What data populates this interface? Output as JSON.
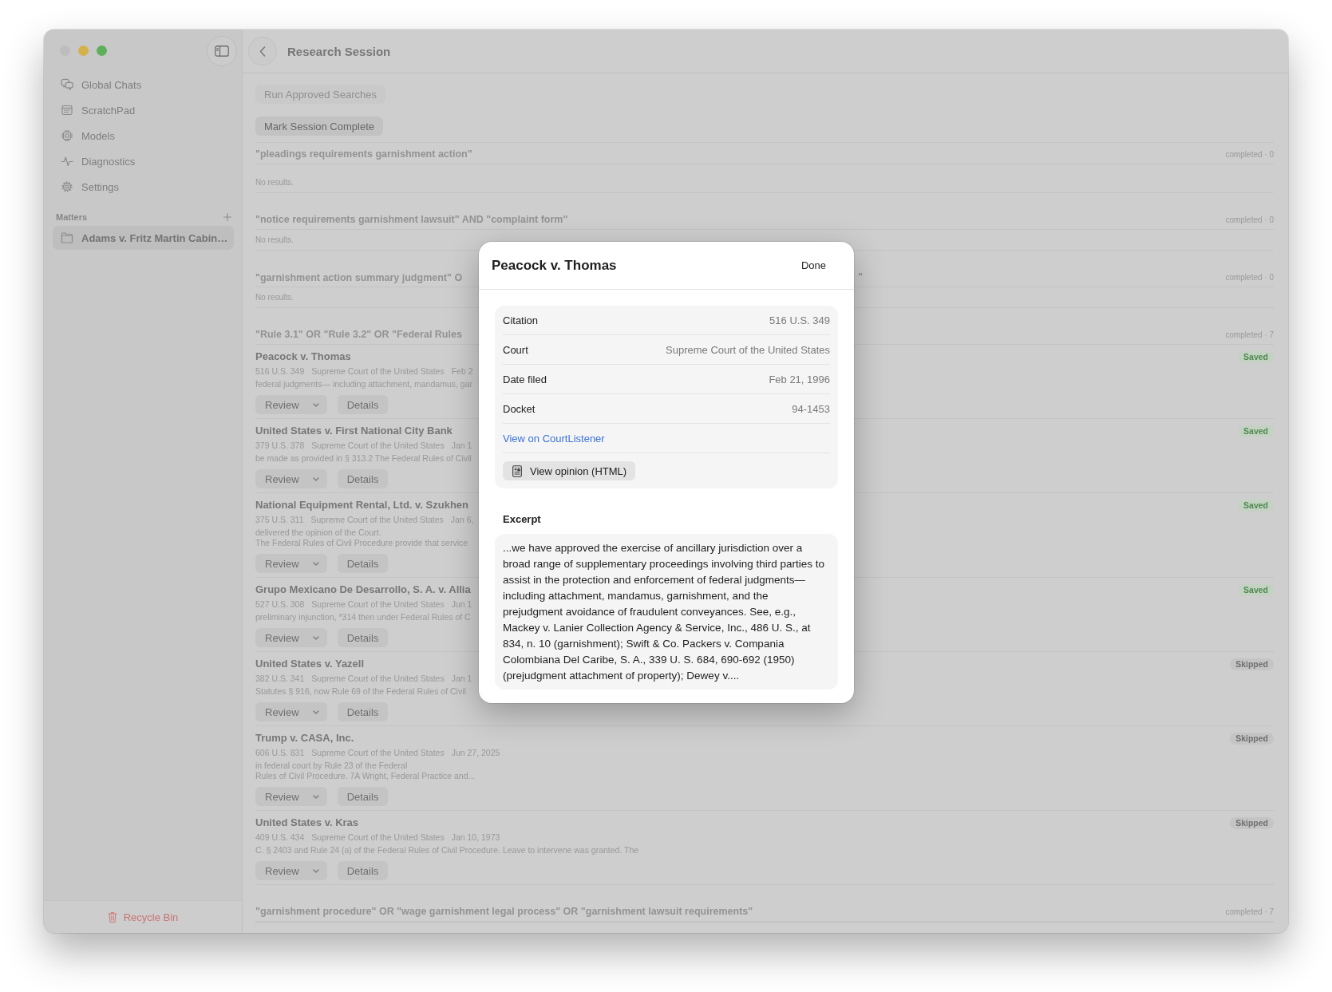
{
  "sidebar": {
    "items": [
      {
        "label": "Global Chats",
        "selected": false
      },
      {
        "label": "ScratchPad",
        "selected": false
      },
      {
        "label": "Models",
        "selected": false
      },
      {
        "label": "Diagnostics",
        "selected": false
      },
      {
        "label": "Settings",
        "selected": false
      }
    ],
    "matters": {
      "title": "Matters",
      "items": [
        {
          "label": "Adams v. Fritz Martin Cabin…",
          "selected": true
        }
      ]
    },
    "footer": {
      "label": "Recycle Bin"
    }
  },
  "header": {
    "title": "Research Session"
  },
  "actions": [
    {
      "label": "Run Approved Searches",
      "disabled": true
    },
    {
      "label": "Mark Session Complete",
      "disabled": false
    }
  ],
  "queries": [
    {
      "text": "\"pleadings requirements garnishment action\"",
      "status": "completed · 0",
      "empty_text": "No results."
    },
    {
      "text": "\"notice requirements garnishment lawsuit\" AND \"complaint form\"",
      "status": "completed · 0",
      "empty_text": "No results."
    },
    {
      "text": "\"garnishment action summary judgment\" O",
      "text_tail": "\"",
      "status": "completed · 0",
      "empty_text": "No results."
    },
    {
      "text": "\"Rule 3.1\" OR \"Rule 3.2\" OR \"Federal Rules",
      "status": "completed · 7",
      "results": [
        {
          "title": "Peacock v. Thomas",
          "citation": "516 U.S. 349",
          "court": "Supreme Court of the United States",
          "date": "Feb 2",
          "snippet": [
            "federal judgments— including attachment, mandamus, gar"
          ],
          "badge": {
            "label": "Saved",
            "kind": "saved"
          },
          "buttons": [
            {
              "label": "Review",
              "kind": "menu"
            },
            {
              "label": "Details",
              "kind": "plain"
            }
          ]
        },
        {
          "title": "United States v. First National City Bank",
          "citation": "379 U.S. 378",
          "court": "Supreme Court of the United States",
          "date": "Jan 1",
          "snippet": [
            "be made as provided in § 313.2 The Federal Rules of Civil"
          ],
          "badge": {
            "label": "Saved",
            "kind": "saved"
          },
          "buttons": [
            {
              "label": "Review",
              "kind": "menu"
            },
            {
              "label": "Details",
              "kind": "plain"
            }
          ]
        },
        {
          "title": "National Equipment Rental, Ltd. v. Szukhen",
          "citation": "375 U.S. 311",
          "court": "Supreme Court of the United States",
          "date": "Jan 6,",
          "snippet": [
            "delivered the opinion of the Court.",
            "The Federal Rules of Civil Procedure provide that service"
          ],
          "badge": {
            "label": "Saved",
            "kind": "saved"
          },
          "buttons": [
            {
              "label": "Review",
              "kind": "menu"
            },
            {
              "label": "Details",
              "kind": "plain"
            }
          ]
        },
        {
          "title": "Grupo Mexicano De Desarrollo, S. A. v. Allia",
          "citation": "527 U.S. 308",
          "court": "Supreme Court of the United States",
          "date": "Jun 1",
          "snippet": [
            "preliminary injunction, *314 then under Federal Rules of C"
          ],
          "badge": {
            "label": "Saved",
            "kind": "saved"
          },
          "buttons": [
            {
              "label": "Review",
              "kind": "menu"
            },
            {
              "label": "Details",
              "kind": "plain"
            }
          ]
        },
        {
          "title": "United States v. Yazell",
          "citation": "382 U.S. 341",
          "court": "Supreme Court of the United States",
          "date": "Jan 1",
          "snippet": [
            "Statutes § 916, now Rule 69 of the Federal Rules of Civil"
          ],
          "badge": {
            "label": "Skipped",
            "kind": "skipped"
          },
          "buttons": [
            {
              "label": "Review",
              "kind": "menu"
            },
            {
              "label": "Details",
              "kind": "plain"
            }
          ]
        },
        {
          "title": "Trump v. CASA, Inc.",
          "citation": "606 U.S. 831",
          "court": "Supreme Court of the United States",
          "date": "Jun 27, 2025",
          "snippet": [
            "in federal court by Rule 23 of the Federal",
            "Rules of Civil Procedure. 7A Wright, Federal Practice and..."
          ],
          "badge": {
            "label": "Skipped",
            "kind": "skipped"
          },
          "buttons": [
            {
              "label": "Review",
              "kind": "menu"
            },
            {
              "label": "Details",
              "kind": "plain"
            }
          ]
        },
        {
          "title": "United States v. Kras",
          "citation": "409 U.S. 434",
          "court": "Supreme Court of the United States",
          "date": "Jan 10, 1973",
          "snippet": [
            "C. § 2403 and Rule 24 (a) of the Federal Rules of Civil Procedure. Leave to intervene was granted. The"
          ],
          "badge": {
            "label": "Skipped",
            "kind": "skipped"
          },
          "buttons": [
            {
              "label": "Review",
              "kind": "menu"
            },
            {
              "label": "Details",
              "kind": "plain"
            }
          ]
        }
      ]
    },
    {
      "text": "\"garnishment procedure\" OR \"wage garnishment legal process\" OR \"garnishment lawsuit requirements\"",
      "status": "completed · 7"
    }
  ],
  "modal": {
    "title": "Peacock v. Thomas",
    "done": "Done",
    "fields": [
      {
        "label": "Citation",
        "value": "516 U.S. 349"
      },
      {
        "label": "Court",
        "value": "Supreme Court of the United States"
      },
      {
        "label": "Date filed",
        "value": "Feb 21, 1996"
      },
      {
        "label": "Docket",
        "value": "94-1453"
      }
    ],
    "link": "View on CourtListener",
    "open_button": "View opinion (HTML)",
    "excerpt_title": "Excerpt",
    "excerpt": "...we have approved the exercise of ancillary jurisdiction over a broad range of supplementary proceedings involving third parties to assist in the protection and enforcement of federal judgments— including attachment, mandamus, garnishment, and the prejudgment avoidance of fraudulent conveyances. See, e.g., Mackey v. Lanier Collection Agency & Service, Inc., 486 U. S., at 834, n. 10 (garnishment); Swift & Co. Packers v. Compania Colombiana Del Caribe, S. A., 339 U. S. 684, 690-692 (1950) (prejudgment attachment of property); Dewey v...."
  }
}
